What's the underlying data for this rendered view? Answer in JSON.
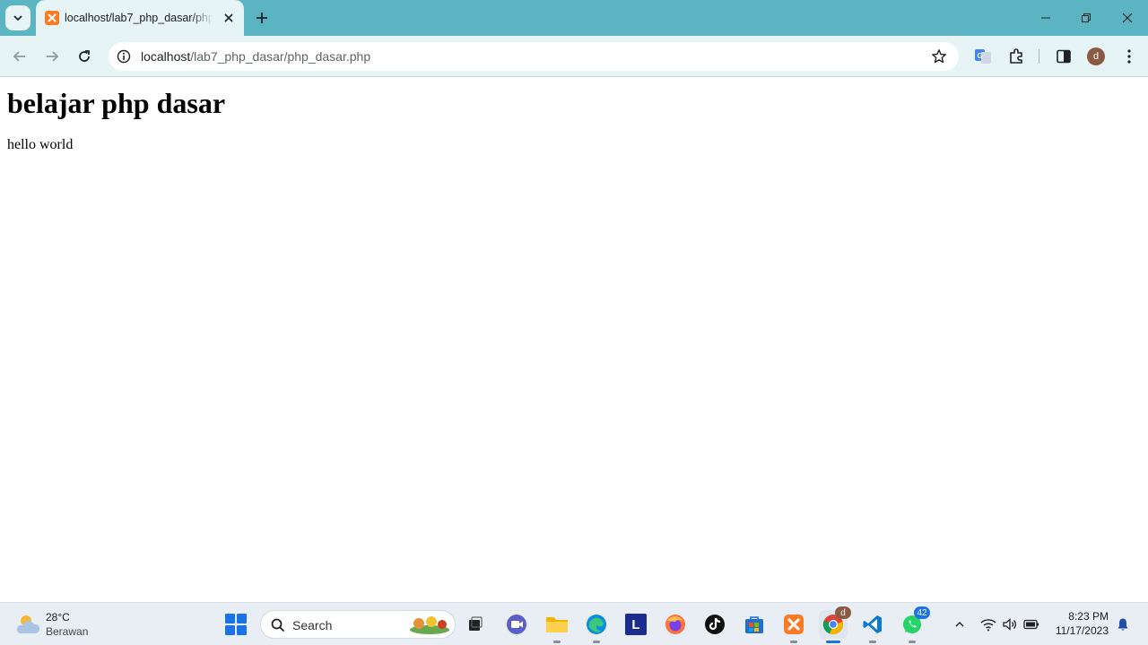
{
  "browser": {
    "tab": {
      "title": "localhost/lab7_php_dasar/php_dasar.php"
    },
    "url": {
      "host": "localhost",
      "path": "/lab7_php_dasar/php_dasar.php"
    },
    "profile_initial": "d"
  },
  "page": {
    "heading": "belajar php dasar",
    "text": "hello world"
  },
  "taskbar": {
    "weather": {
      "temp": "28°C",
      "condition": "Berawan",
      "icon": "partly-cloudy-icon"
    },
    "search_label": "Search",
    "apps": [
      {
        "name": "task-view",
        "icon": "task-view-icon"
      },
      {
        "name": "meet",
        "icon": "meet-icon"
      },
      {
        "name": "file-explorer",
        "icon": "folder-icon"
      },
      {
        "name": "edge",
        "icon": "edge-icon"
      },
      {
        "name": "l-app",
        "icon": "l-icon",
        "letter": "L"
      },
      {
        "name": "firefox",
        "icon": "firefox-icon"
      },
      {
        "name": "tiktok",
        "icon": "tiktok-icon"
      },
      {
        "name": "store",
        "icon": "store-icon"
      },
      {
        "name": "xampp",
        "icon": "xampp-icon"
      },
      {
        "name": "chrome",
        "icon": "chrome-icon",
        "badge": "d"
      },
      {
        "name": "vscode",
        "icon": "vscode-icon"
      },
      {
        "name": "whatsapp",
        "icon": "whatsapp-icon",
        "badge": "42"
      }
    ],
    "clock": {
      "time": "8:23 PM",
      "date": "11/17/2023"
    }
  },
  "colors": {
    "tabstrip": "#5bb4c1",
    "toolbar": "#e6f4f6",
    "accent": "#1a73e8"
  }
}
